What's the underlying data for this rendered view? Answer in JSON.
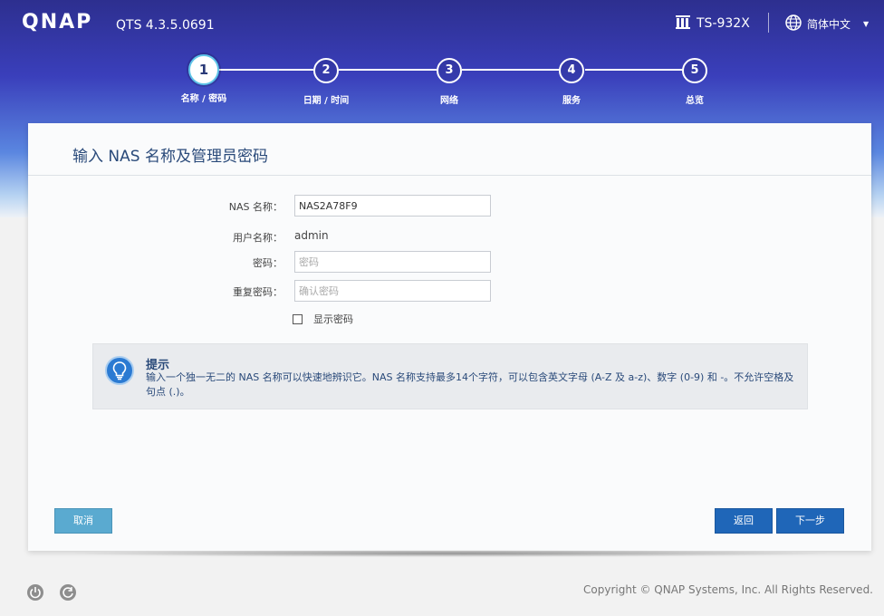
{
  "header": {
    "logo": "QNAP",
    "version": "QTS 4.3.5.0691",
    "device_icon": "server-icon",
    "device_name": "TS-932X",
    "language_icon": "globe-icon",
    "language": "简体中文",
    "language_dropdown_icon": "caret-down-icon"
  },
  "steps": [
    {
      "number": "1",
      "label": "名称 / 密码",
      "active": true
    },
    {
      "number": "2",
      "label": "日期 / 时间",
      "active": false
    },
    {
      "number": "3",
      "label": "网络",
      "active": false
    },
    {
      "number": "4",
      "label": "服务",
      "active": false
    },
    {
      "number": "5",
      "label": "总览",
      "active": false
    }
  ],
  "card": {
    "title": "输入 NAS 名称及管理员密码",
    "form": {
      "nas_name_label": "NAS 名称：",
      "nas_name_value": "NAS2A78F9",
      "username_label": "用户名称：",
      "username_value": "admin",
      "password_label": "密码：",
      "password_placeholder": "密码",
      "confirm_label": "重复密码：",
      "confirm_placeholder": "确认密码",
      "show_password_label": "显示密码",
      "show_password_checked": false
    },
    "hint": {
      "icon": "lightbulb-icon",
      "title": "提示",
      "text": "输入一个独一无二的 NAS 名称可以快速地辨识它。NAS 名称支持最多14个字符，可以包含英文字母 (A-Z 及 a-z)、数字 (0-9) 和 -。不允许空格及句点 (.)。"
    },
    "buttons": {
      "cancel": "取消",
      "back": "返回",
      "next": "下一步"
    }
  },
  "footer": {
    "icons": [
      "power-icon",
      "refresh-icon"
    ],
    "copyright": "Copyright © QNAP Systems, Inc. All Rights Reserved."
  },
  "colors": {
    "primary_button": "#1f66b8",
    "cancel_button": "#5aaad0",
    "title_text": "#2a4a7a"
  }
}
